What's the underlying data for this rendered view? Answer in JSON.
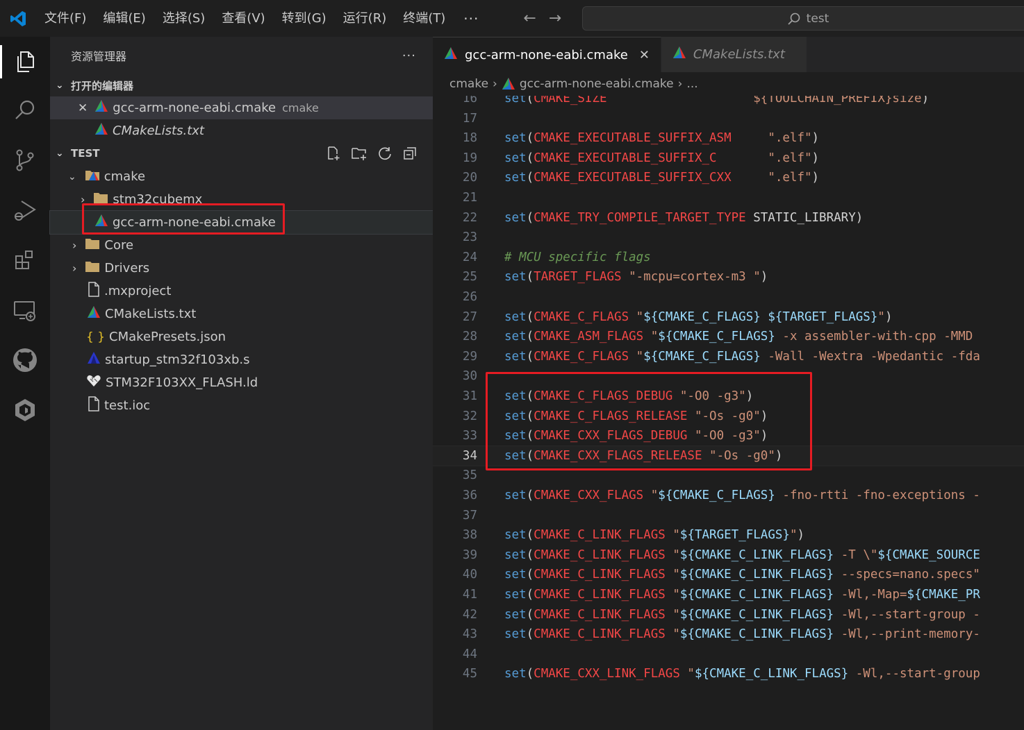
{
  "titlebar": {
    "menu": [
      "文件(F)",
      "编辑(E)",
      "选择(S)",
      "查看(V)",
      "转到(G)",
      "运行(R)",
      "终端(T)"
    ],
    "more": "···",
    "back": "←",
    "forward": "→",
    "search_text": "test"
  },
  "sidebar": {
    "title": "资源管理器",
    "title_more": "···",
    "open_editors_header": "打开的编辑器",
    "open_editors": [
      {
        "name": "gcc-arm-none-eabi.cmake",
        "folder": "cmake",
        "close": "✕"
      },
      {
        "name": "CMakeLists.txt"
      }
    ],
    "project_header": "TEST",
    "tree": [
      {
        "label": "cmake"
      },
      {
        "label": "stm32cubemx"
      },
      {
        "label": "gcc-arm-none-eabi.cmake"
      },
      {
        "label": "Core"
      },
      {
        "label": "Drivers"
      },
      {
        "label": ".mxproject"
      },
      {
        "label": "CMakeLists.txt"
      },
      {
        "label": "CMakePresets.json"
      },
      {
        "label": "startup_stm32f103xb.s"
      },
      {
        "label": "STM32F103XX_FLASH.ld"
      },
      {
        "label": "test.ioc"
      }
    ],
    "json_icon_glyph": "{ }"
  },
  "editor": {
    "tabs": [
      {
        "label": "gcc-arm-none-eabi.cmake",
        "close": "✕"
      },
      {
        "label": "CMakeLists.txt"
      }
    ],
    "breadcrumb": [
      "cmake",
      "gcc-arm-none-eabi.cmake",
      "..."
    ],
    "breadcrumb_sep": "›",
    "active_line": 34,
    "lines": [
      {
        "n": "16",
        "t": [
          [
            "k",
            "set"
          ],
          [
            "p",
            "("
          ],
          [
            "v",
            "CMAKE_SIZE"
          ],
          [
            "p",
            "                    "
          ],
          [
            "s",
            "${TOOLCHAIN_PREFIX}size"
          ],
          [
            "p",
            ")"
          ]
        ]
      },
      {
        "n": "17",
        "t": []
      },
      {
        "n": "18",
        "t": [
          [
            "k",
            "set"
          ],
          [
            "p",
            "("
          ],
          [
            "v",
            "CMAKE_EXECUTABLE_SUFFIX_ASM"
          ],
          [
            "p",
            "     "
          ],
          [
            "s",
            "\".elf\""
          ],
          [
            "p",
            ")"
          ]
        ]
      },
      {
        "n": "19",
        "t": [
          [
            "k",
            "set"
          ],
          [
            "p",
            "("
          ],
          [
            "v",
            "CMAKE_EXECUTABLE_SUFFIX_C"
          ],
          [
            "p",
            "       "
          ],
          [
            "s",
            "\".elf\""
          ],
          [
            "p",
            ")"
          ]
        ]
      },
      {
        "n": "20",
        "t": [
          [
            "k",
            "set"
          ],
          [
            "p",
            "("
          ],
          [
            "v",
            "CMAKE_EXECUTABLE_SUFFIX_CXX"
          ],
          [
            "p",
            "     "
          ],
          [
            "s",
            "\".elf\""
          ],
          [
            "p",
            ")"
          ]
        ]
      },
      {
        "n": "21",
        "t": []
      },
      {
        "n": "22",
        "t": [
          [
            "k",
            "set"
          ],
          [
            "p",
            "("
          ],
          [
            "v",
            "CMAKE_TRY_COMPILE_TARGET_TYPE"
          ],
          [
            "p",
            " STATIC_LIBRARY)"
          ]
        ]
      },
      {
        "n": "23",
        "t": []
      },
      {
        "n": "24",
        "t": [
          [
            "cm",
            "# MCU specific flags"
          ]
        ]
      },
      {
        "n": "25",
        "t": [
          [
            "k",
            "set"
          ],
          [
            "p",
            "("
          ],
          [
            "v",
            "TARGET_FLAGS"
          ],
          [
            "p",
            " "
          ],
          [
            "s",
            "\"-mcpu=cortex-m3 \""
          ],
          [
            "p",
            ")"
          ]
        ]
      },
      {
        "n": "26",
        "t": []
      },
      {
        "n": "27",
        "t": [
          [
            "k",
            "set"
          ],
          [
            "p",
            "("
          ],
          [
            "v",
            "CMAKE_C_FLAGS"
          ],
          [
            "p",
            " "
          ],
          [
            "s",
            "\""
          ],
          [
            "i",
            "${CMAKE_C_FLAGS}"
          ],
          [
            "s",
            " "
          ],
          [
            "i",
            "${TARGET_FLAGS}"
          ],
          [
            "s",
            "\""
          ],
          [
            "p",
            ")"
          ]
        ]
      },
      {
        "n": "28",
        "t": [
          [
            "k",
            "set"
          ],
          [
            "p",
            "("
          ],
          [
            "v",
            "CMAKE_ASM_FLAGS"
          ],
          [
            "p",
            " "
          ],
          [
            "s",
            "\""
          ],
          [
            "i",
            "${CMAKE_C_FLAGS}"
          ],
          [
            "s",
            " -x assembler-with-cpp -MMD"
          ]
        ]
      },
      {
        "n": "29",
        "t": [
          [
            "k",
            "set"
          ],
          [
            "p",
            "("
          ],
          [
            "v",
            "CMAKE_C_FLAGS"
          ],
          [
            "p",
            " "
          ],
          [
            "s",
            "\""
          ],
          [
            "i",
            "${CMAKE_C_FLAGS}"
          ],
          [
            "s",
            " -Wall -Wextra -Wpedantic -fda"
          ]
        ]
      },
      {
        "n": "30",
        "t": []
      },
      {
        "n": "31",
        "t": [
          [
            "k",
            "set"
          ],
          [
            "p",
            "("
          ],
          [
            "v",
            "CMAKE_C_FLAGS_DEBUG"
          ],
          [
            "p",
            " "
          ],
          [
            "s",
            "\"-O0 -g3\""
          ],
          [
            "p",
            ")"
          ]
        ]
      },
      {
        "n": "32",
        "t": [
          [
            "k",
            "set"
          ],
          [
            "p",
            "("
          ],
          [
            "v",
            "CMAKE_C_FLAGS_RELEASE"
          ],
          [
            "p",
            " "
          ],
          [
            "s",
            "\"-Os -g0\""
          ],
          [
            "p",
            ")"
          ]
        ]
      },
      {
        "n": "33",
        "t": [
          [
            "k",
            "set"
          ],
          [
            "p",
            "("
          ],
          [
            "v",
            "CMAKE_CXX_FLAGS_DEBUG"
          ],
          [
            "p",
            " "
          ],
          [
            "s",
            "\"-O0 -g3\""
          ],
          [
            "p",
            ")"
          ]
        ]
      },
      {
        "n": "34",
        "t": [
          [
            "k",
            "set"
          ],
          [
            "p",
            "("
          ],
          [
            "v",
            "CMAKE_CXX_FLAGS_RELEASE"
          ],
          [
            "p",
            " "
          ],
          [
            "s",
            "\"-Os -g0\""
          ],
          [
            "p",
            ")"
          ]
        ]
      },
      {
        "n": "35",
        "t": []
      },
      {
        "n": "36",
        "t": [
          [
            "k",
            "set"
          ],
          [
            "p",
            "("
          ],
          [
            "v",
            "CMAKE_CXX_FLAGS"
          ],
          [
            "p",
            " "
          ],
          [
            "s",
            "\""
          ],
          [
            "i",
            "${CMAKE_C_FLAGS}"
          ],
          [
            "s",
            " -fno-rtti -fno-exceptions -"
          ]
        ]
      },
      {
        "n": "37",
        "t": []
      },
      {
        "n": "38",
        "t": [
          [
            "k",
            "set"
          ],
          [
            "p",
            "("
          ],
          [
            "v",
            "CMAKE_C_LINK_FLAGS"
          ],
          [
            "p",
            " "
          ],
          [
            "s",
            "\""
          ],
          [
            "i",
            "${TARGET_FLAGS}"
          ],
          [
            "s",
            "\""
          ],
          [
            "p",
            ")"
          ]
        ]
      },
      {
        "n": "39",
        "t": [
          [
            "k",
            "set"
          ],
          [
            "p",
            "("
          ],
          [
            "v",
            "CMAKE_C_LINK_FLAGS"
          ],
          [
            "p",
            " "
          ],
          [
            "s",
            "\""
          ],
          [
            "i",
            "${CMAKE_C_LINK_FLAGS}"
          ],
          [
            "s",
            " -T \\\""
          ],
          [
            "i",
            "${CMAKE_SOURCE"
          ]
        ]
      },
      {
        "n": "40",
        "t": [
          [
            "k",
            "set"
          ],
          [
            "p",
            "("
          ],
          [
            "v",
            "CMAKE_C_LINK_FLAGS"
          ],
          [
            "p",
            " "
          ],
          [
            "s",
            "\""
          ],
          [
            "i",
            "${CMAKE_C_LINK_FLAGS}"
          ],
          [
            "s",
            " --specs=nano.specs\""
          ]
        ]
      },
      {
        "n": "41",
        "t": [
          [
            "k",
            "set"
          ],
          [
            "p",
            "("
          ],
          [
            "v",
            "CMAKE_C_LINK_FLAGS"
          ],
          [
            "p",
            " "
          ],
          [
            "s",
            "\""
          ],
          [
            "i",
            "${CMAKE_C_LINK_FLAGS}"
          ],
          [
            "s",
            " -Wl,-Map="
          ],
          [
            "i",
            "${CMAKE_PR"
          ]
        ]
      },
      {
        "n": "42",
        "t": [
          [
            "k",
            "set"
          ],
          [
            "p",
            "("
          ],
          [
            "v",
            "CMAKE_C_LINK_FLAGS"
          ],
          [
            "p",
            " "
          ],
          [
            "s",
            "\""
          ],
          [
            "i",
            "${CMAKE_C_LINK_FLAGS}"
          ],
          [
            "s",
            " -Wl,--start-group -"
          ]
        ]
      },
      {
        "n": "43",
        "t": [
          [
            "k",
            "set"
          ],
          [
            "p",
            "("
          ],
          [
            "v",
            "CMAKE_C_LINK_FLAGS"
          ],
          [
            "p",
            " "
          ],
          [
            "s",
            "\""
          ],
          [
            "i",
            "${CMAKE_C_LINK_FLAGS}"
          ],
          [
            "s",
            " -Wl,--print-memory-"
          ]
        ]
      },
      {
        "n": "44",
        "t": []
      },
      {
        "n": "45",
        "t": [
          [
            "k",
            "set"
          ],
          [
            "p",
            "("
          ],
          [
            "v",
            "CMAKE_CXX_LINK_FLAGS"
          ],
          [
            "p",
            " "
          ],
          [
            "s",
            "\""
          ],
          [
            "i",
            "${CMAKE_C_LINK_FLAGS}"
          ],
          [
            "s",
            " -Wl,--start-group"
          ]
        ]
      }
    ]
  },
  "colors": {
    "accent_blue": "#569cd6",
    "variable_red": "#f44747",
    "string_orange": "#ce9178",
    "highlight_box": "#e51c23"
  }
}
